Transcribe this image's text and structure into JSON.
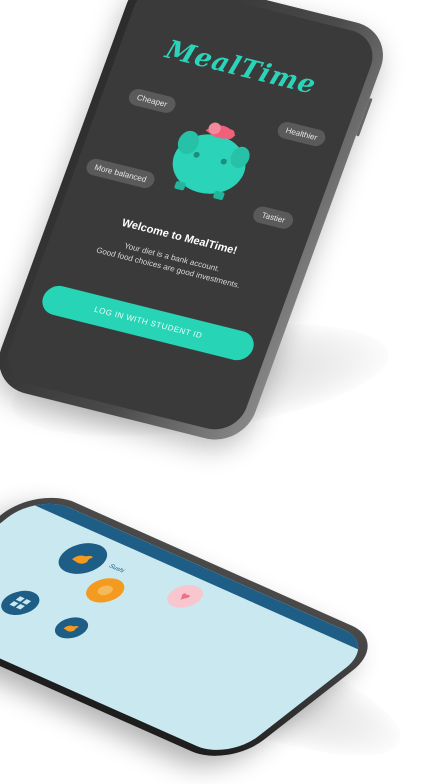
{
  "phone_top": {
    "app_name": "MealTime",
    "benefits": [
      "Cheaper",
      "Healthier",
      "More balanced",
      "Tastier"
    ],
    "welcome_title": "Welcome to MealTime!",
    "tagline_line1": "Your diet is a bank account.",
    "tagline_line2": "Good food choices are good investments.",
    "login_button": "LOG IN WITH STUDENT ID",
    "colors": {
      "accent": "#28d4b6",
      "screen": "#3a3a3a"
    }
  },
  "phone_bottom": {
    "labels": [
      "Sushi",
      "",
      "",
      "",
      ""
    ],
    "colors": {
      "screen": "#c9e8f0",
      "bar": "#1e5d86",
      "orange": "#f39a1f",
      "pink": "#f06e83"
    },
    "icons": [
      "chicken-icon",
      "orange-food-icon",
      "heart-icon",
      "grid-icon",
      "chicken-icon"
    ]
  }
}
